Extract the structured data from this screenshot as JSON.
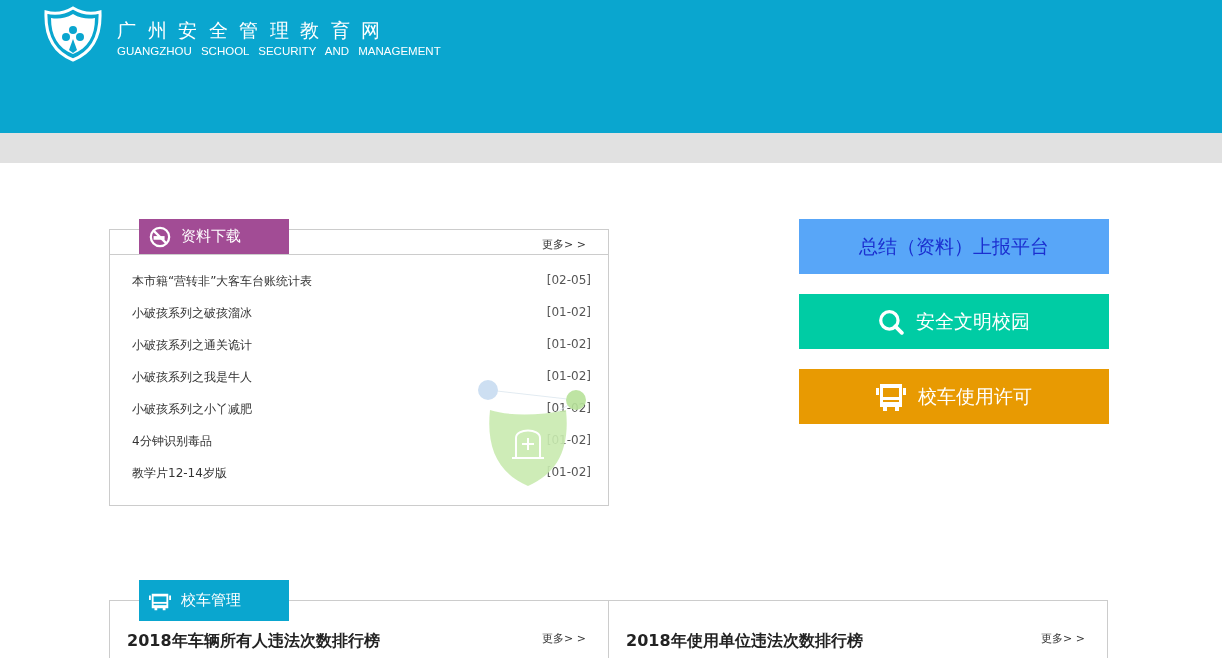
{
  "header": {
    "title": "广州安全管理教育网",
    "subtitle": "GUANGZHOU SCHOOL SECURITY AND MANAGEMENT"
  },
  "downloads": {
    "title": "资料下载",
    "more": "更多> >",
    "items": [
      {
        "title": "本市籍“营转非”大客车台账统计表",
        "date": "[02-05]"
      },
      {
        "title": "小破孩系列之破孩溜冰",
        "date": "[01-02]"
      },
      {
        "title": "小破孩系列之通关诡计",
        "date": "[01-02]"
      },
      {
        "title": "小破孩系列之我是牛人",
        "date": "[01-02]"
      },
      {
        "title": "小破孩系列之小丫减肥",
        "date": "[01-02]"
      },
      {
        "title": "4分钟识别毒品",
        "date": "[01-02]"
      },
      {
        "title": "教学片12-14岁版",
        "date": "[01-02]"
      }
    ]
  },
  "quick_links": [
    {
      "kind": "plain",
      "label": "总结（资料）上报平台",
      "color": "#58a6f8"
    },
    {
      "kind": "search",
      "label": "安全文明校园",
      "color": "#00cca4"
    },
    {
      "kind": "bus",
      "label": "校车使用许可",
      "color": "#e89a02"
    }
  ],
  "bus_panel": {
    "title": "校车管理",
    "columns": [
      {
        "title": "2018年车辆所有人违法次数排行榜",
        "more": "更多> >"
      },
      {
        "title": "2018年使用单位违法次数排行榜",
        "more": "更多> >"
      }
    ]
  }
}
